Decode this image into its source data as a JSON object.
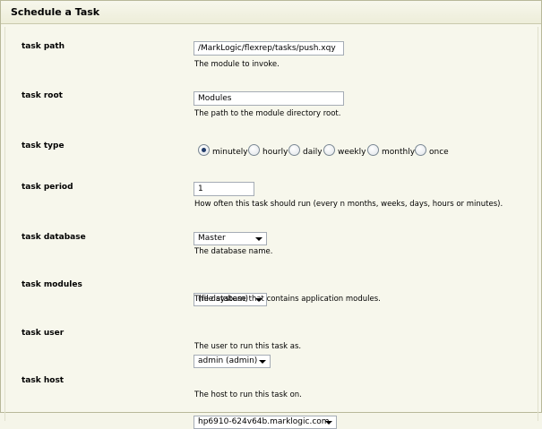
{
  "title": "Schedule a Task",
  "fields": {
    "task_path": {
      "label": "task path",
      "value": "/MarkLogic/flexrep/tasks/push.xqy",
      "help": "The module to invoke."
    },
    "task_root": {
      "label": "task root",
      "value": "Modules",
      "help": "The path to the module directory root."
    },
    "task_type": {
      "label": "task type",
      "options": [
        "minutely",
        "hourly",
        "daily",
        "weekly",
        "monthly",
        "once"
      ],
      "selected": "minutely"
    },
    "task_period": {
      "label": "task period",
      "value": "1",
      "help": "How often this task should run (every n months, weeks, days, hours or minutes)."
    },
    "task_database": {
      "label": "task database",
      "value": "Master",
      "help": "The database name."
    },
    "task_modules": {
      "label": "task modules",
      "value": "(file system)",
      "help": "The database that contains application modules."
    },
    "task_user": {
      "label": "task user",
      "value": "admin (admin)",
      "help": "The user to run this task as."
    },
    "task_host": {
      "label": "task host",
      "value": "hp6910-624v64b.marklogic.com",
      "help": "The host to run this task on."
    }
  }
}
